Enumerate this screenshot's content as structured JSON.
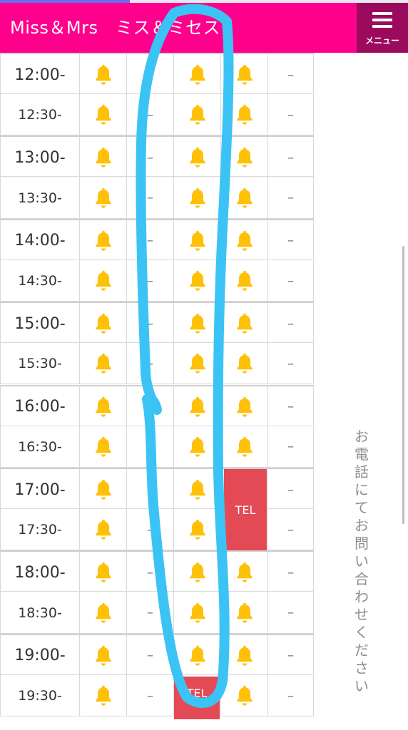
{
  "header": {
    "title": "Miss＆Mrs　ミス＆ミセス",
    "menu_label": "メニュー",
    "menu_icon": "hamburger-menu-icon",
    "bg_color": "#ff008c",
    "menu_bg_color": "#9b0a5c"
  },
  "schedule": {
    "rows": [
      {
        "time": "12:00-",
        "c1": "bell",
        "c2": "",
        "c3": "bell",
        "c4": "bell",
        "c5": "–"
      },
      {
        "time": "12:30-",
        "c1": "bell",
        "c2": "–",
        "c3": "bell",
        "c4": "bell",
        "c5": "–"
      },
      {
        "time": "13:00-",
        "c1": "bell",
        "c2": "–",
        "c3": "bell",
        "c4": "bell",
        "c5": "–"
      },
      {
        "time": "13:30-",
        "c1": "bell",
        "c2": "–",
        "c3": "bell",
        "c4": "bell",
        "c5": "–"
      },
      {
        "time": "14:00-",
        "c1": "bell",
        "c2": "–",
        "c3": "bell",
        "c4": "bell",
        "c5": "–"
      },
      {
        "time": "14:30-",
        "c1": "bell",
        "c2": "–",
        "c3": "bell",
        "c4": "bell",
        "c5": "–"
      },
      {
        "time": "15:00-",
        "c1": "bell",
        "c2": "–",
        "c3": "bell",
        "c4": "bell",
        "c5": "–"
      },
      {
        "time": "15:30-",
        "c1": "bell",
        "c2": "–",
        "c3": "bell",
        "c4": "bell",
        "c5": "–"
      },
      {
        "time": "16:00-",
        "c1": "bell",
        "c2": "–",
        "c3": "bell",
        "c4": "bell",
        "c5": "–"
      },
      {
        "time": "16:30-",
        "c1": "bell",
        "c2": "–",
        "c3": "bell",
        "c4": "bell",
        "c5": "–"
      },
      {
        "time": "17:00-",
        "c1": "bell",
        "c2": "–",
        "c3": "bell",
        "c4": "",
        "c5": "–"
      },
      {
        "time": "17:30-",
        "c1": "bell",
        "c2": "–",
        "c3": "bell",
        "c4": "",
        "c5": "–"
      },
      {
        "time": "18:00-",
        "c1": "bell",
        "c2": "–",
        "c3": "bell",
        "c4": "bell",
        "c5": "–"
      },
      {
        "time": "18:30-",
        "c1": "bell",
        "c2": "–",
        "c3": "bell",
        "c4": "bell",
        "c5": "–"
      },
      {
        "time": "19:00-",
        "c1": "bell",
        "c2": "–",
        "c3": "bell",
        "c4": "bell",
        "c5": "–"
      },
      {
        "time": "19:30-",
        "c1": "bell",
        "c2": "–",
        "c3": "",
        "c4": "bell",
        "c5": "–"
      }
    ],
    "tel_block_1": "TEL",
    "tel_block_2": "TEL",
    "bell_icon": "bell-icon",
    "bell_color": "#ffc107",
    "tel_color": "#e34a55"
  },
  "sidebar": {
    "note": "お電話にてお問い合わせください"
  },
  "annotation": {
    "stroke_color": "#3cc3f5"
  }
}
